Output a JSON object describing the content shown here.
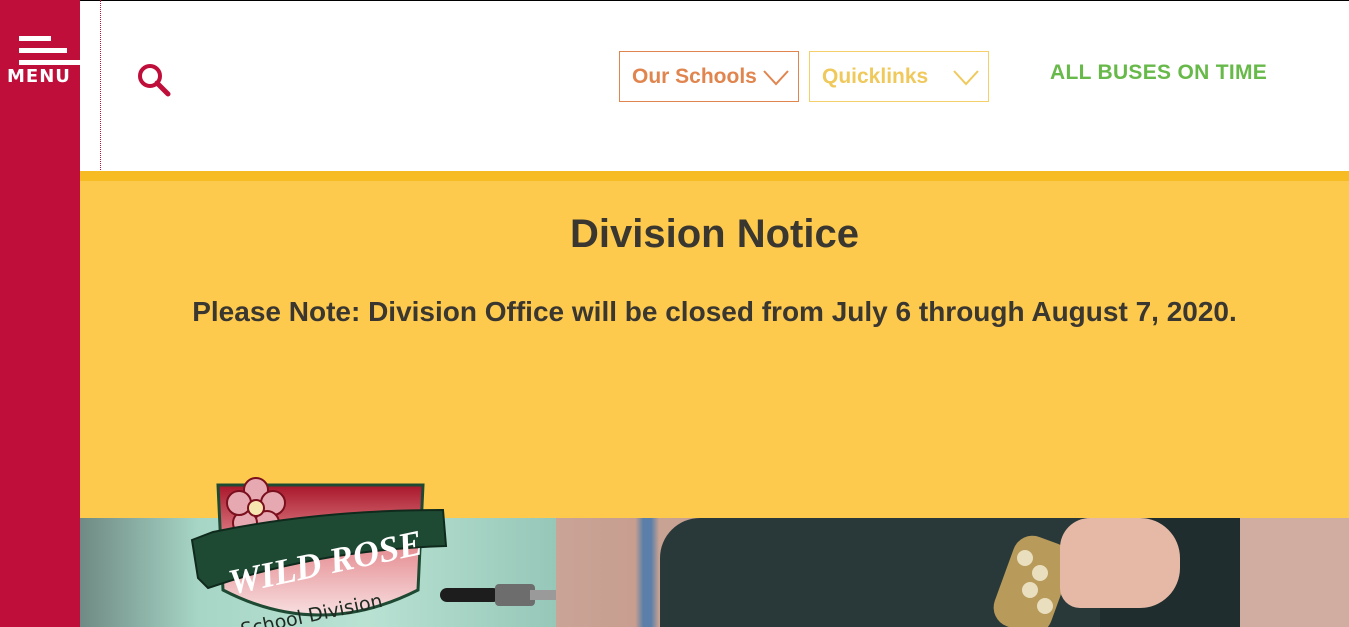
{
  "sidebar": {
    "menu_label": "MENU"
  },
  "header": {
    "dropdowns": [
      {
        "label": "Our Schools",
        "color": "#e1854f"
      },
      {
        "label": "Quicklinks",
        "color": "#f0c95c"
      }
    ],
    "bus_status": "ALL BUSES ON TIME",
    "bus_status_color": "#67b94a"
  },
  "notice": {
    "title": "Division Notice",
    "body": "Please Note: Division Office will be closed from July 6 through August 7, 2020."
  },
  "logo": {
    "line1": "WILD ROSE",
    "line2": "School Division"
  },
  "colors": {
    "brand": "#bf0e3a",
    "notice_bg": "#fdca4e",
    "notice_border": "#f7bc23",
    "logo_green": "#1e4a33"
  }
}
